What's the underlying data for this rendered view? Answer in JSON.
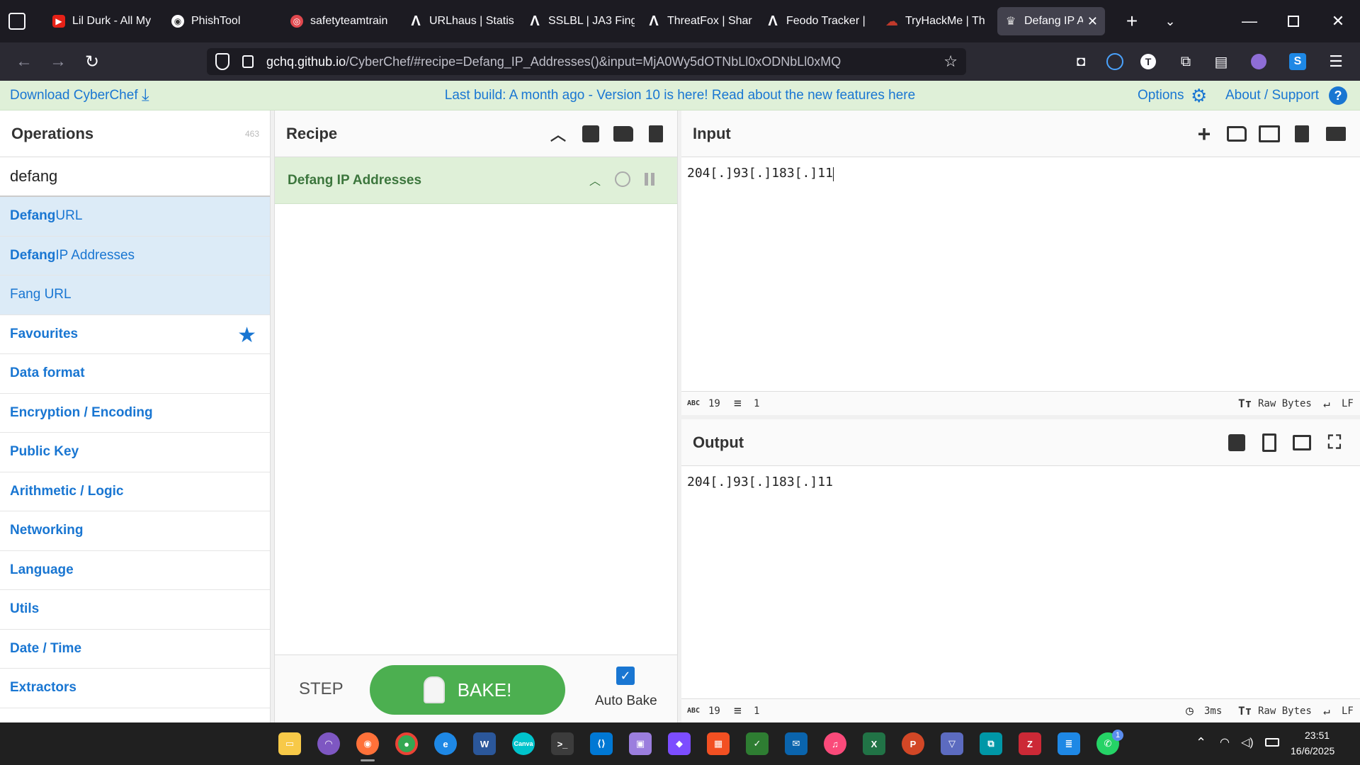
{
  "browser": {
    "tabs": [
      {
        "label": "Lil Durk - All My",
        "icon_color": "#e62117",
        "icon": "▶"
      },
      {
        "label": "PhishTool",
        "icon_color": "#6b6b6b",
        "icon": "◉"
      },
      {
        "label": "safetyteamtrain",
        "icon_color": "#e0484e",
        "icon": "◎"
      },
      {
        "label": "URLhaus | Statis",
        "icon_color": "#1c1b22",
        "icon": "Λ"
      },
      {
        "label": "SSLBL | JA3 Fing",
        "icon_color": "#1c1b22",
        "icon": "Λ"
      },
      {
        "label": "ThreatFox | Shar",
        "icon_color": "#1c1b22",
        "icon": "Λ"
      },
      {
        "label": "Feodo Tracker |",
        "icon_color": "#1c1b22",
        "icon": "Λ"
      },
      {
        "label": "TryHackMe | Th",
        "icon_color": "#c0392b",
        "icon": "☁"
      },
      {
        "label": "Defang IP Ad",
        "icon_color": "#cccccc",
        "icon": "♛"
      }
    ],
    "url_domain": "gchq.github.io",
    "url_path": "/CyberChef/#recipe=Defang_IP_Addresses()&input=MjA0Wy5dOTNbLl0xODNbLl0xMQ"
  },
  "banner": {
    "download": "Download CyberChef",
    "build": "Last build: A month ago - Version 10 is here! Read about the new features here",
    "options": "Options",
    "about": "About / Support"
  },
  "operations": {
    "title": "Operations",
    "count": "463",
    "search_value": "defang",
    "matches": [
      {
        "bold": "Defang",
        "rest": " URL"
      },
      {
        "bold": "Defang",
        "rest": " IP Addresses"
      },
      {
        "bold": "",
        "rest": "Fang URL"
      }
    ],
    "categories": [
      "Favourites",
      "Data format",
      "Encryption / Encoding",
      "Public Key",
      "Arithmetic / Logic",
      "Networking",
      "Language",
      "Utils",
      "Date / Time",
      "Extractors"
    ]
  },
  "recipe": {
    "title": "Recipe",
    "op_name": "Defang IP Addresses",
    "step_label": "STEP",
    "bake_label": "BAKE!",
    "autobake_label": "Auto Bake"
  },
  "input": {
    "title": "Input",
    "value": "204[.]93[.]183[.]11",
    "chars": "19",
    "lines": "1",
    "encoding": "Raw Bytes",
    "eol": "LF"
  },
  "output": {
    "title": "Output",
    "value": "204[.]93[.]183[.]11",
    "chars": "19",
    "lines": "1",
    "time": "3ms",
    "encoding": "Raw Bytes",
    "eol": "LF"
  },
  "taskbar": {
    "time": "23:51",
    "date": "16/6/2025",
    "whatsapp_badge": "1"
  },
  "colors": {
    "accent": "#1976d2",
    "banner_bg": "#dff0d8",
    "bake_green": "#4caf50",
    "recipe_op_bg": "#dff0d8",
    "recipe_op_text": "#3c763d"
  }
}
